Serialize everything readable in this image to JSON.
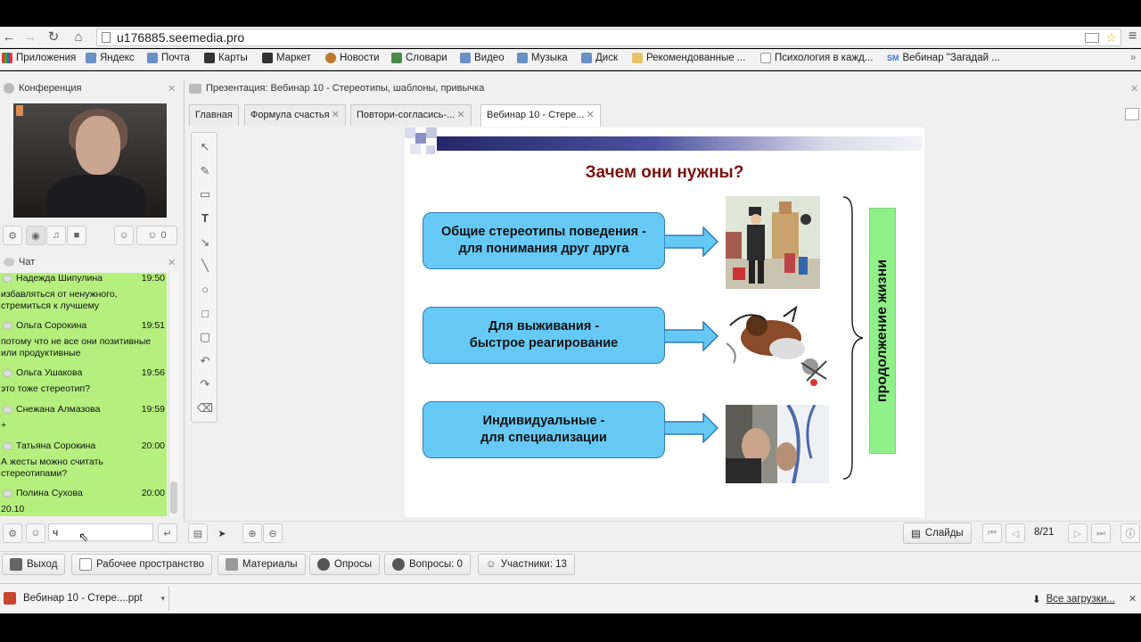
{
  "browser": {
    "url": "u176885.seemedia.pro",
    "bookmarks": [
      "Приложения",
      "Яндекс",
      "Почта",
      "Карты",
      "Маркет",
      "Новости",
      "Словари",
      "Видео",
      "Музыка",
      "Диск",
      "Рекомендованные ...",
      "Психология в кажд...",
      "Вебинар \"Загадай ..."
    ]
  },
  "conference": {
    "title": "Конференция",
    "participants_count": "0"
  },
  "chat": {
    "title": "Чат",
    "input_value": "ч",
    "messages": [
      {
        "name": "Надежда Шипулина",
        "time": "19:50",
        "text": "избавляться от ненужного, стремиться к лучшему"
      },
      {
        "name": "Ольга Сорокина",
        "time": "19:51",
        "text": "потому что не все они позитивные или продуктивные"
      },
      {
        "name": "Ольга Ушакова",
        "time": "19:56",
        "text": "это тоже стереотип?"
      },
      {
        "name": "Снежана Алмазова",
        "time": "19:59",
        "text": "+"
      },
      {
        "name": "Татьяна Сорокина",
        "time": "20:00",
        "text": "А жесты можно считать стереотипами?"
      },
      {
        "name": "Полина Сухова",
        "time": "20:00",
        "text": "20.10"
      }
    ]
  },
  "presentation": {
    "title": "Презентация: Вебинар 10 - Стереотипы, шаблоны, привычка",
    "tabs": [
      "Главная",
      "Формула счастья",
      "Повтори-согласись-...",
      "Вебинар 10 - Стере..."
    ],
    "slide": {
      "title": "Зачем они нужны?",
      "boxes": [
        {
          "line1": "Общие стереотипы поведения -",
          "line2": "для понимания друг друга"
        },
        {
          "line1": "Для выживания -",
          "line2": "быстрое реагирование"
        },
        {
          "line1": "Индивидуальные -",
          "line2": "для специализации"
        }
      ],
      "side_label": "продолжение жизни"
    },
    "slides_button": "Слайды",
    "page_indicator": "8/21"
  },
  "menu": {
    "items": [
      "Выход",
      "Рабочее пространство",
      "Материалы",
      "Опросы",
      "Вопросы: 0",
      "Участники: 13"
    ]
  },
  "downloads": {
    "file": "Вебинар 10 - Стере....ppt",
    "all": "Все загрузки..."
  },
  "colors": {
    "chat_bg": "#b5f07f",
    "box_bg": "#66c9f5",
    "title_color": "#7a1212",
    "side_bar": "#8ff08a"
  }
}
